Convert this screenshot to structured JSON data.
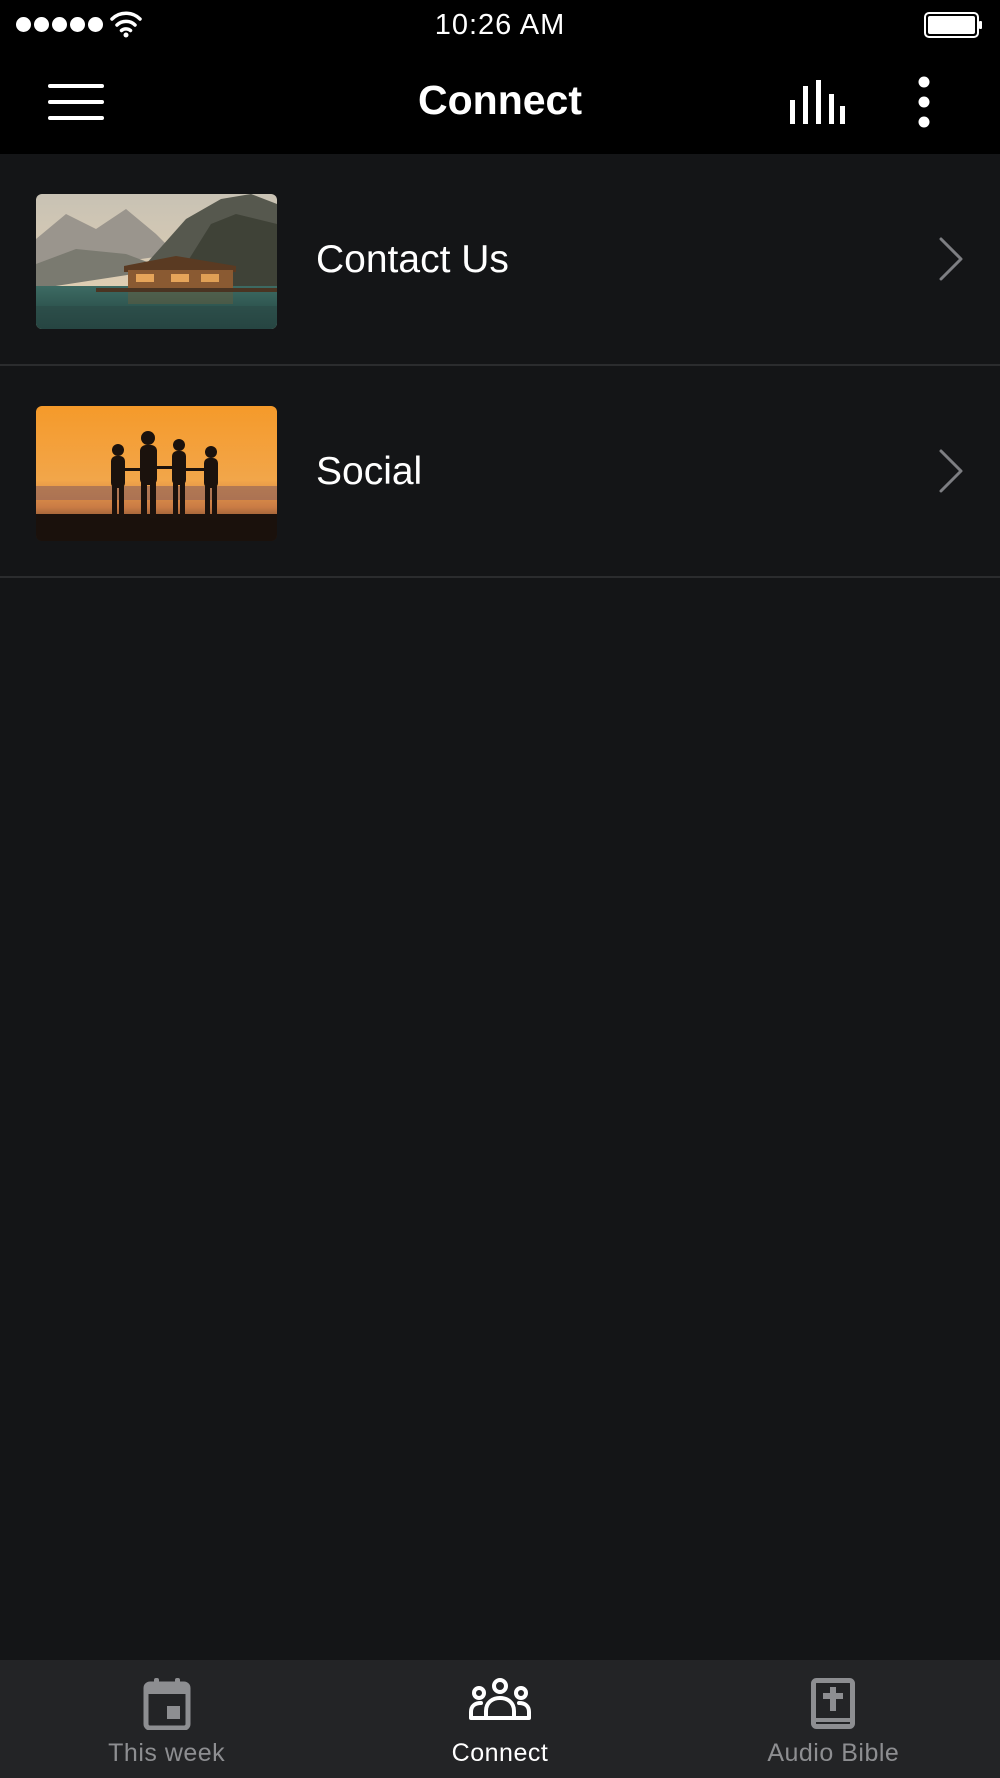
{
  "status_bar": {
    "time": "10:26 AM",
    "signal_icon": "signal-dots-icon",
    "wifi_icon": "wifi-icon",
    "battery_icon": "battery-icon",
    "battery_level": 1.0
  },
  "nav": {
    "title": "Connect",
    "menu_icon": "hamburger-menu-icon",
    "equalizer_icon": "equalizer-icon",
    "more_icon": "more-vertical-icon"
  },
  "list": {
    "items": [
      {
        "label": "Contact Us",
        "image": "lake-cabin-mountains-photo",
        "chevron_icon": "chevron-right-icon"
      },
      {
        "label": "Social",
        "image": "family-sunset-silhouette-photo",
        "chevron_icon": "chevron-right-icon"
      }
    ]
  },
  "tab_bar": {
    "tabs": [
      {
        "label": "This week",
        "icon": "calendar-icon",
        "active": false
      },
      {
        "label": "Connect",
        "icon": "group-icon",
        "active": true
      },
      {
        "label": "Audio Bible",
        "icon": "bible-icon",
        "active": false
      }
    ]
  },
  "colors": {
    "background": "#141517",
    "header": "#000000",
    "tab_bar": "#232426",
    "active_tab": "#ffffff",
    "inactive_tab": "#8d8e91",
    "divider": "#2b2c2e"
  }
}
